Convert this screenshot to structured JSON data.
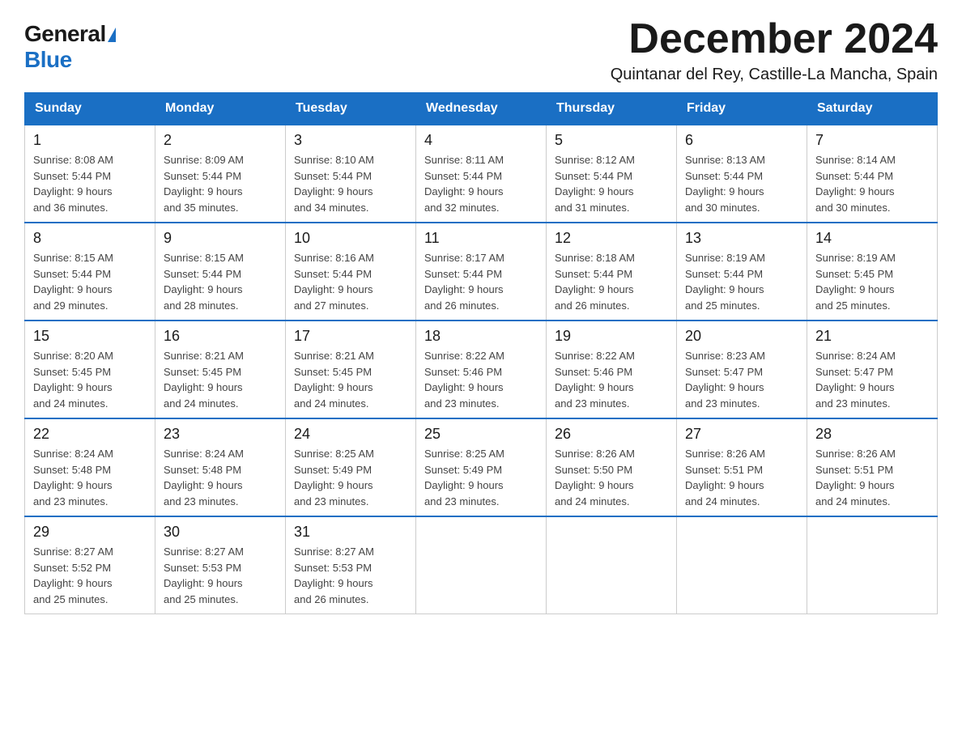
{
  "logo": {
    "general": "General",
    "blue": "Blue"
  },
  "title": "December 2024",
  "subtitle": "Quintanar del Rey, Castille-La Mancha, Spain",
  "weekdays": [
    "Sunday",
    "Monday",
    "Tuesday",
    "Wednesday",
    "Thursday",
    "Friday",
    "Saturday"
  ],
  "weeks": [
    [
      {
        "day": "1",
        "sunrise": "8:08 AM",
        "sunset": "5:44 PM",
        "daylight": "9 hours and 36 minutes."
      },
      {
        "day": "2",
        "sunrise": "8:09 AM",
        "sunset": "5:44 PM",
        "daylight": "9 hours and 35 minutes."
      },
      {
        "day": "3",
        "sunrise": "8:10 AM",
        "sunset": "5:44 PM",
        "daylight": "9 hours and 34 minutes."
      },
      {
        "day": "4",
        "sunrise": "8:11 AM",
        "sunset": "5:44 PM",
        "daylight": "9 hours and 32 minutes."
      },
      {
        "day": "5",
        "sunrise": "8:12 AM",
        "sunset": "5:44 PM",
        "daylight": "9 hours and 31 minutes."
      },
      {
        "day": "6",
        "sunrise": "8:13 AM",
        "sunset": "5:44 PM",
        "daylight": "9 hours and 30 minutes."
      },
      {
        "day": "7",
        "sunrise": "8:14 AM",
        "sunset": "5:44 PM",
        "daylight": "9 hours and 30 minutes."
      }
    ],
    [
      {
        "day": "8",
        "sunrise": "8:15 AM",
        "sunset": "5:44 PM",
        "daylight": "9 hours and 29 minutes."
      },
      {
        "day": "9",
        "sunrise": "8:15 AM",
        "sunset": "5:44 PM",
        "daylight": "9 hours and 28 minutes."
      },
      {
        "day": "10",
        "sunrise": "8:16 AM",
        "sunset": "5:44 PM",
        "daylight": "9 hours and 27 minutes."
      },
      {
        "day": "11",
        "sunrise": "8:17 AM",
        "sunset": "5:44 PM",
        "daylight": "9 hours and 26 minutes."
      },
      {
        "day": "12",
        "sunrise": "8:18 AM",
        "sunset": "5:44 PM",
        "daylight": "9 hours and 26 minutes."
      },
      {
        "day": "13",
        "sunrise": "8:19 AM",
        "sunset": "5:44 PM",
        "daylight": "9 hours and 25 minutes."
      },
      {
        "day": "14",
        "sunrise": "8:19 AM",
        "sunset": "5:45 PM",
        "daylight": "9 hours and 25 minutes."
      }
    ],
    [
      {
        "day": "15",
        "sunrise": "8:20 AM",
        "sunset": "5:45 PM",
        "daylight": "9 hours and 24 minutes."
      },
      {
        "day": "16",
        "sunrise": "8:21 AM",
        "sunset": "5:45 PM",
        "daylight": "9 hours and 24 minutes."
      },
      {
        "day": "17",
        "sunrise": "8:21 AM",
        "sunset": "5:45 PM",
        "daylight": "9 hours and 24 minutes."
      },
      {
        "day": "18",
        "sunrise": "8:22 AM",
        "sunset": "5:46 PM",
        "daylight": "9 hours and 23 minutes."
      },
      {
        "day": "19",
        "sunrise": "8:22 AM",
        "sunset": "5:46 PM",
        "daylight": "9 hours and 23 minutes."
      },
      {
        "day": "20",
        "sunrise": "8:23 AM",
        "sunset": "5:47 PM",
        "daylight": "9 hours and 23 minutes."
      },
      {
        "day": "21",
        "sunrise": "8:24 AM",
        "sunset": "5:47 PM",
        "daylight": "9 hours and 23 minutes."
      }
    ],
    [
      {
        "day": "22",
        "sunrise": "8:24 AM",
        "sunset": "5:48 PM",
        "daylight": "9 hours and 23 minutes."
      },
      {
        "day": "23",
        "sunrise": "8:24 AM",
        "sunset": "5:48 PM",
        "daylight": "9 hours and 23 minutes."
      },
      {
        "day": "24",
        "sunrise": "8:25 AM",
        "sunset": "5:49 PM",
        "daylight": "9 hours and 23 minutes."
      },
      {
        "day": "25",
        "sunrise": "8:25 AM",
        "sunset": "5:49 PM",
        "daylight": "9 hours and 23 minutes."
      },
      {
        "day": "26",
        "sunrise": "8:26 AM",
        "sunset": "5:50 PM",
        "daylight": "9 hours and 24 minutes."
      },
      {
        "day": "27",
        "sunrise": "8:26 AM",
        "sunset": "5:51 PM",
        "daylight": "9 hours and 24 minutes."
      },
      {
        "day": "28",
        "sunrise": "8:26 AM",
        "sunset": "5:51 PM",
        "daylight": "9 hours and 24 minutes."
      }
    ],
    [
      {
        "day": "29",
        "sunrise": "8:27 AM",
        "sunset": "5:52 PM",
        "daylight": "9 hours and 25 minutes."
      },
      {
        "day": "30",
        "sunrise": "8:27 AM",
        "sunset": "5:53 PM",
        "daylight": "9 hours and 25 minutes."
      },
      {
        "day": "31",
        "sunrise": "8:27 AM",
        "sunset": "5:53 PM",
        "daylight": "9 hours and 26 minutes."
      },
      null,
      null,
      null,
      null
    ]
  ]
}
